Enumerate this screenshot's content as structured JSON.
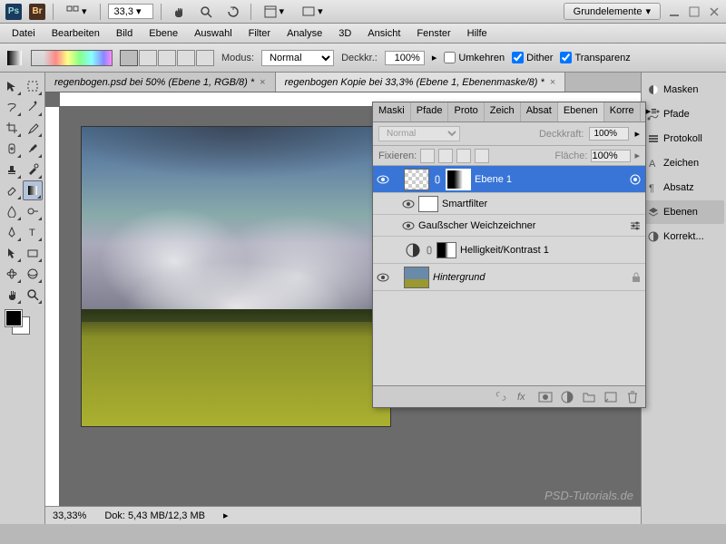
{
  "titlebar": {
    "zoom": "33,3",
    "workspace": "Grundelemente"
  },
  "menu": [
    "Datei",
    "Bearbeiten",
    "Bild",
    "Ebene",
    "Auswahl",
    "Filter",
    "Analyse",
    "3D",
    "Ansicht",
    "Fenster",
    "Hilfe"
  ],
  "options": {
    "mode_label": "Modus:",
    "mode_value": "Normal",
    "opacity_label": "Deckkr.:",
    "opacity_value": "100%",
    "reverse": "Umkehren",
    "dither": "Dither",
    "transparency": "Transparenz"
  },
  "tabs": [
    {
      "label": "regenbogen.psd bei 50% (Ebene 1, RGB/8) *",
      "active": false
    },
    {
      "label": "regenbogen Kopie bei 33,3% (Ebene 1, Ebenenmaske/8) *",
      "active": true
    }
  ],
  "status": {
    "zoom": "33,33%",
    "doc": "Dok: 5,43 MB/12,3 MB"
  },
  "watermark": "PSD-Tutorials.de",
  "layers_panel": {
    "tabs": [
      "Maski",
      "Pfade",
      "Proto",
      "Zeich",
      "Absat",
      "Ebenen",
      "Korre"
    ],
    "active_tab": "Ebenen",
    "blend_mode": "Normal",
    "opacity_label": "Deckkraft:",
    "opacity": "100%",
    "lock_label": "Fixieren:",
    "fill_label": "Fläche:",
    "fill": "100%",
    "layers": [
      {
        "name": "Ebene 1",
        "selected": true,
        "visible": true
      },
      {
        "name": "Smartfilter",
        "sub": true,
        "visible": true
      },
      {
        "name": "Gaußscher Weichzeichner",
        "sub": true,
        "visible": true
      },
      {
        "name": "Helligkeit/Kontrast 1",
        "visible": false
      },
      {
        "name": "Hintergrund",
        "italic": true,
        "locked": true,
        "visible": true
      }
    ]
  },
  "dock": [
    {
      "label": "Masken",
      "icon": "mask"
    },
    {
      "label": "Pfade",
      "icon": "path"
    },
    {
      "label": "Protokoll",
      "icon": "history"
    },
    {
      "label": "Zeichen",
      "icon": "char"
    },
    {
      "label": "Absatz",
      "icon": "para"
    },
    {
      "label": "Ebenen",
      "icon": "layers",
      "active": true
    },
    {
      "label": "Korrekt...",
      "icon": "adjust"
    }
  ]
}
